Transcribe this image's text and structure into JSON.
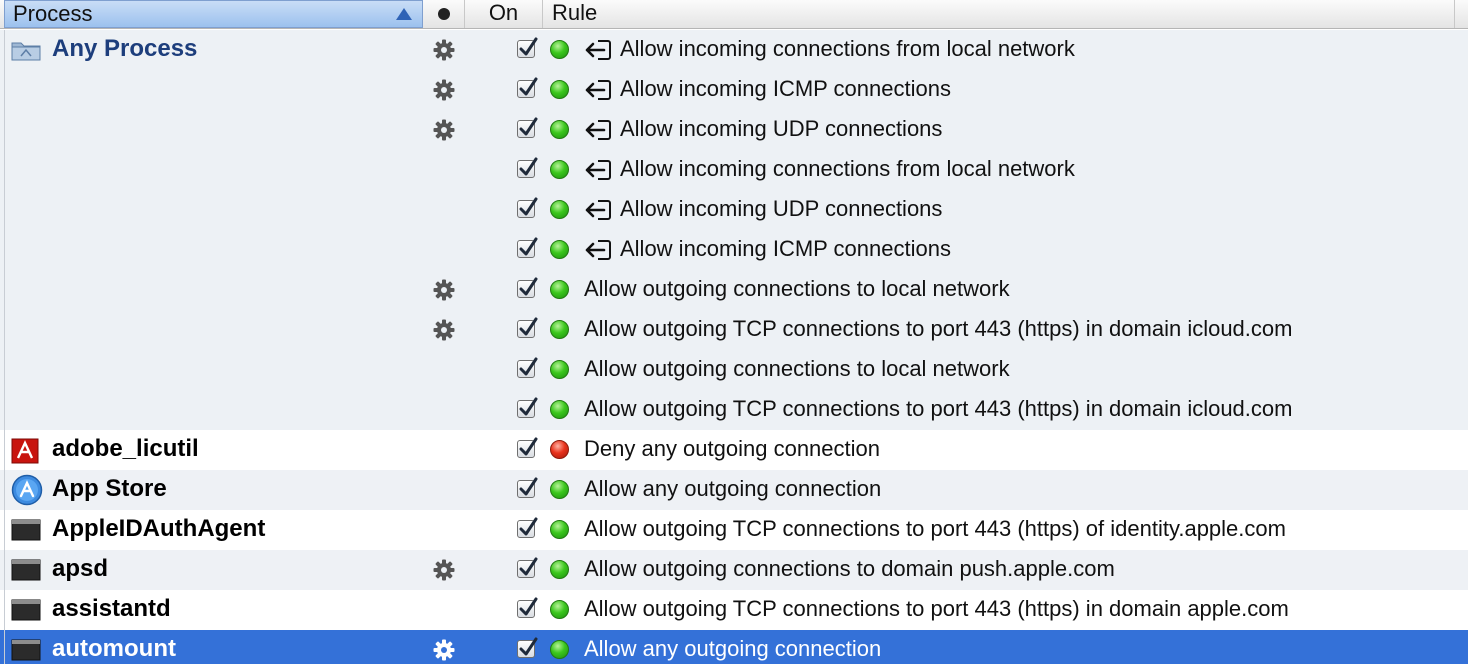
{
  "header": {
    "process_label": "Process",
    "on_label": "On",
    "rule_label": "Rule",
    "active_icon": "bullet-dot"
  },
  "colors": {
    "selection": "#3471d8",
    "group_background": "#edf1f5",
    "allow_led": "#3bc71d",
    "deny_led": "#e8321c",
    "any_process_text": "#1d3e7c"
  },
  "rows": [
    {
      "process": "Any Process",
      "icon": "folder-icon",
      "gear": true,
      "checked": true,
      "status": "allow",
      "direction": "incoming",
      "rule": "Allow incoming connections from local network"
    },
    {
      "process": "",
      "icon": "",
      "gear": true,
      "checked": true,
      "status": "allow",
      "direction": "incoming",
      "rule": "Allow incoming ICMP connections"
    },
    {
      "process": "",
      "icon": "",
      "gear": true,
      "checked": true,
      "status": "allow",
      "direction": "incoming",
      "rule": "Allow incoming UDP connections"
    },
    {
      "process": "",
      "icon": "",
      "gear": false,
      "checked": true,
      "status": "allow",
      "direction": "incoming",
      "rule": "Allow incoming connections from local network"
    },
    {
      "process": "",
      "icon": "",
      "gear": false,
      "checked": true,
      "status": "allow",
      "direction": "incoming",
      "rule": "Allow incoming UDP connections"
    },
    {
      "process": "",
      "icon": "",
      "gear": false,
      "checked": true,
      "status": "allow",
      "direction": "incoming",
      "rule": "Allow incoming ICMP connections"
    },
    {
      "process": "",
      "icon": "",
      "gear": true,
      "checked": true,
      "status": "allow",
      "direction": "outgoing",
      "rule": "Allow outgoing connections to local network"
    },
    {
      "process": "",
      "icon": "",
      "gear": true,
      "checked": true,
      "status": "allow",
      "direction": "outgoing",
      "rule": "Allow outgoing TCP connections to port 443 (https) in domain icloud.com"
    },
    {
      "process": "",
      "icon": "",
      "gear": false,
      "checked": true,
      "status": "allow",
      "direction": "outgoing",
      "rule": "Allow outgoing connections to local network"
    },
    {
      "process": "",
      "icon": "",
      "gear": false,
      "checked": true,
      "status": "allow",
      "direction": "outgoing",
      "rule": "Allow outgoing TCP connections to port 443 (https) in domain icloud.com"
    },
    {
      "process": "adobe_licutil",
      "icon": "adobe-icon",
      "gear": false,
      "checked": true,
      "status": "deny",
      "direction": "outgoing",
      "rule": "Deny any outgoing connection"
    },
    {
      "process": "App Store",
      "icon": "app-store-icon",
      "gear": false,
      "checked": true,
      "status": "allow",
      "direction": "outgoing",
      "rule": "Allow any outgoing connection"
    },
    {
      "process": "AppleIDAuthAgent",
      "icon": "terminal-icon",
      "gear": false,
      "checked": true,
      "status": "allow",
      "direction": "outgoing",
      "rule": "Allow outgoing TCP connections to port 443 (https) of identity.apple.com"
    },
    {
      "process": "apsd",
      "icon": "terminal-icon",
      "gear": true,
      "checked": true,
      "status": "allow",
      "direction": "outgoing",
      "rule": "Allow outgoing connections to domain push.apple.com"
    },
    {
      "process": "assistantd",
      "icon": "terminal-icon",
      "gear": false,
      "checked": true,
      "status": "allow",
      "direction": "outgoing",
      "rule": "Allow outgoing TCP connections to port 443 (https) in domain apple.com"
    },
    {
      "process": "automount",
      "icon": "terminal-icon",
      "gear": true,
      "checked": true,
      "status": "allow",
      "direction": "outgoing",
      "rule": "Allow any outgoing connection",
      "selected": true
    }
  ]
}
